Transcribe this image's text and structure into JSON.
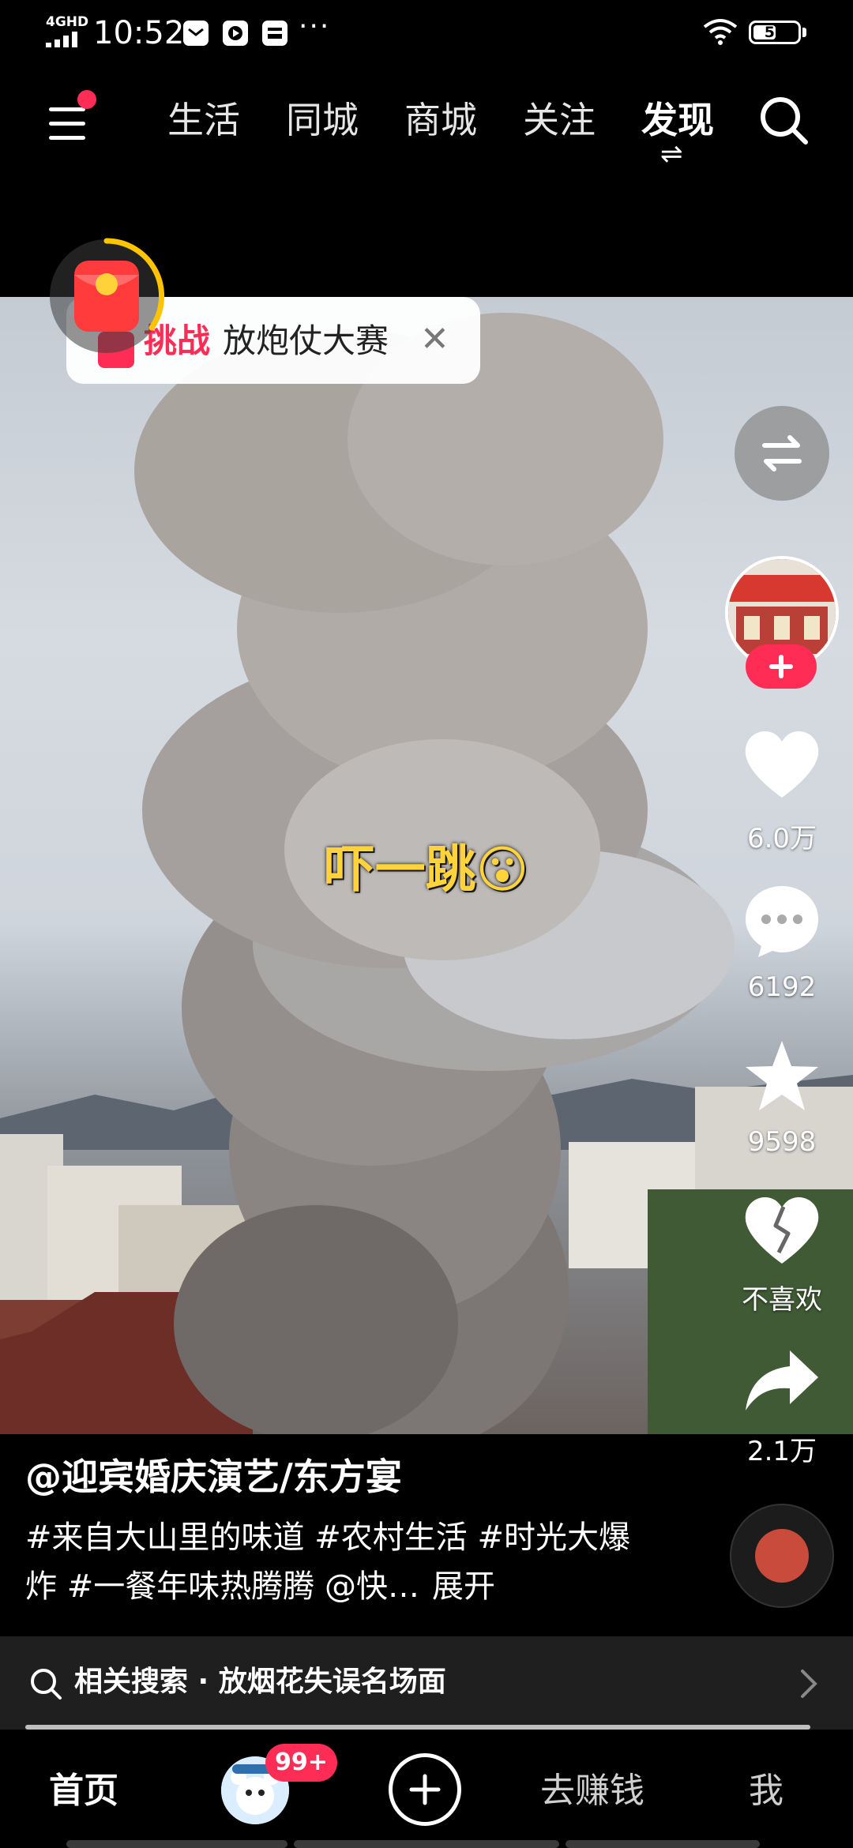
{
  "status_bar": {
    "network": "4GHD",
    "time": "10:52",
    "more": "···",
    "battery": "51",
    "battery_level_percent": 51
  },
  "top_nav": {
    "tabs": [
      {
        "label": "生活"
      },
      {
        "label": "同城"
      },
      {
        "label": "商城"
      },
      {
        "label": "关注"
      },
      {
        "label": "发现"
      }
    ],
    "active_tab": "发现",
    "active_tab_indicator": "⇌"
  },
  "video": {
    "caption": "吓一跳",
    "caption_emoji": "😮",
    "challenge": {
      "tag": "挑战",
      "name": "放炮仗大赛",
      "close": "✕"
    }
  },
  "right_rail": {
    "likes": "6.0万",
    "comments": "6192",
    "favorites": "9598",
    "dislike_label": "不喜欢",
    "shares": "2.1万"
  },
  "post": {
    "author": "@迎宾婚庆演艺/东方宴",
    "description": "#来自大山里的味道 #农村生活 #时光大爆炸 #一餐年味热腾腾 @快…",
    "expand_label": "展开"
  },
  "related_search": {
    "label": "相关搜索 · 放烟花失误名场面"
  },
  "playback_progress_percent": 100,
  "bottom_tabs": {
    "home": "首页",
    "badge": "99+",
    "earn": "去赚钱",
    "me": "我"
  },
  "colors": {
    "accent": "#ff2d55",
    "caption": "#ffd33a",
    "background": "#000000"
  },
  "icons": [
    "menu-icon",
    "search-icon",
    "swap-icon",
    "heart-icon",
    "comment-icon",
    "star-icon",
    "broken-heart-icon",
    "share-icon",
    "plus-icon",
    "chevron-right-icon",
    "red-packet-icon",
    "music-disc-icon"
  ]
}
